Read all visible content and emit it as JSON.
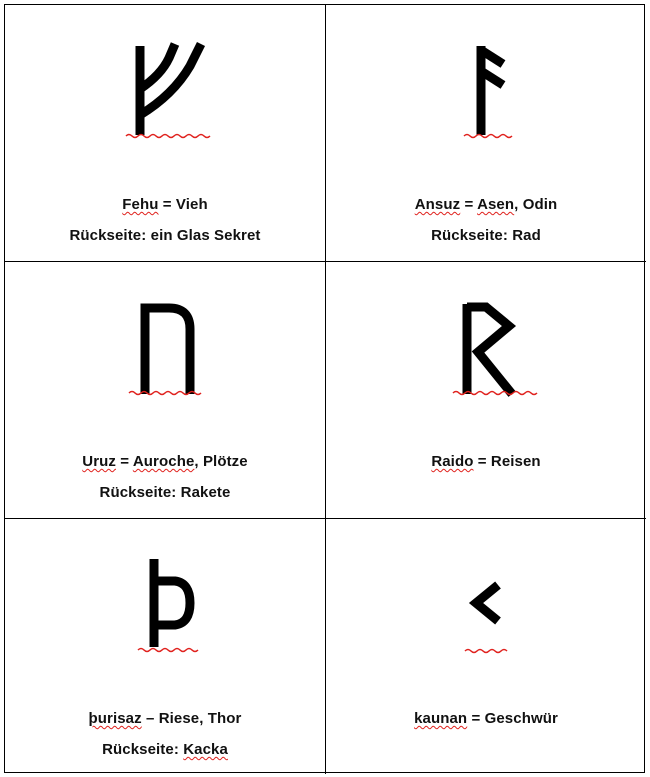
{
  "cards": [
    {
      "rune_icon": "fehu-rune",
      "name": "Fehu",
      "sep": " = ",
      "meaning": "Vieh",
      "meaning_spell": "",
      "back_label": "Rückseite:",
      "back_value": "ein Glas Sekret",
      "back_spell": ""
    },
    {
      "rune_icon": "ansuz-rune",
      "name": "Ansuz",
      "sep": " = ",
      "meaning": ", Odin",
      "meaning_spell": "Asen",
      "back_label": "Rückseite:",
      "back_value": "Rad",
      "back_spell": ""
    },
    {
      "rune_icon": "uruz-rune",
      "name": "Uruz",
      "sep": " = ",
      "meaning": ", Plötze",
      "meaning_spell": "Auroche",
      "back_label": "Rückseite:",
      "back_value": "Rakete",
      "back_spell": ""
    },
    {
      "rune_icon": "raido-rune",
      "name": "Raido",
      "sep": " = ",
      "meaning": "Reisen",
      "meaning_spell": "",
      "back_label": "",
      "back_value": "",
      "back_spell": ""
    },
    {
      "rune_icon": "thurisaz-rune",
      "name": "þurisaz",
      "sep": " – ",
      "meaning": "Riese, Thor",
      "meaning_spell": "",
      "back_label": "Rückseite:",
      "back_value": "",
      "back_spell": "Kacka"
    },
    {
      "rune_icon": "kaunan-rune",
      "name": "kaunan",
      "sep": " = ",
      "meaning": "Geschwür",
      "meaning_spell": "",
      "back_label": "",
      "back_value": "",
      "back_spell": ""
    }
  ],
  "colors": {
    "ink": "#000000",
    "spellcheck": "#e0211d",
    "border": "#000000"
  }
}
